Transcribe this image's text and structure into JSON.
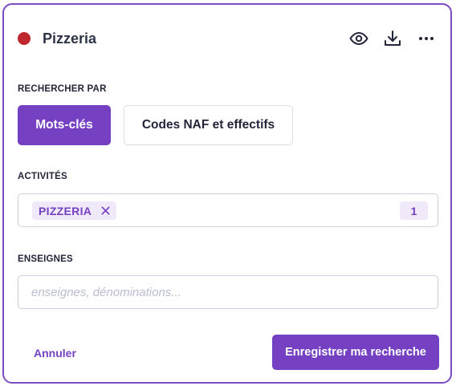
{
  "header": {
    "title": "Pizzeria",
    "status_color": "#c0272d",
    "actions": [
      "eye-icon",
      "download-icon",
      "more-horizontal-icon"
    ]
  },
  "search_by": {
    "label": "RECHERCHER PAR",
    "options": [
      "Mots-clés",
      "Codes NAF et effectifs"
    ],
    "selected": "Mots-clés"
  },
  "activities": {
    "label": "ACTIVITÉS",
    "tags": [
      "PIZZERIA"
    ],
    "count": "1"
  },
  "brands": {
    "label": "ENSEIGNES",
    "placeholder": "enseignes, dénominations...",
    "value": ""
  },
  "footer": {
    "cancel_label": "Annuler",
    "save_label": "Enregistrer ma recherche"
  },
  "colors": {
    "accent": "#7541c2",
    "border": "#7a4cc2",
    "tag_bg": "#efe9fa"
  }
}
